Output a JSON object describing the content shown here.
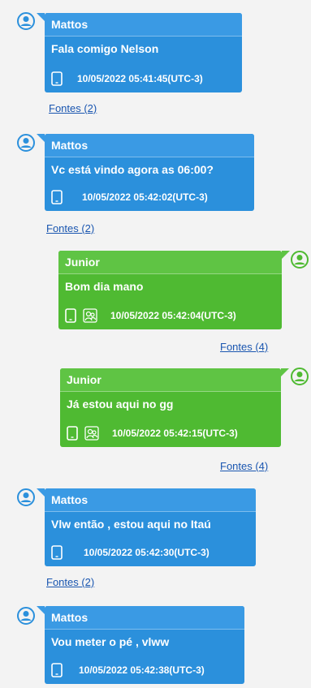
{
  "colors": {
    "incoming_bubble": "#2b90dc",
    "outgoing_bubble": "#4fba32",
    "link": "#1a56b0",
    "background": "#f3f3f3"
  },
  "messages": [
    {
      "sender": "Mattos",
      "text": "Fala comigo Nelson",
      "timestamp": "10/05/2022 05:41:45(UTC-3)",
      "sources": "Fontes (2)",
      "icons": [
        "phone-icon"
      ]
    },
    {
      "sender": "Mattos",
      "text": "Vc está vindo agora as 06:00?",
      "timestamp": "10/05/2022 05:42:02(UTC-3)",
      "sources": "Fontes (2)",
      "icons": [
        "phone-icon"
      ]
    },
    {
      "sender": "Junior",
      "text": "Bom dia mano",
      "timestamp": "10/05/2022 05:42:04(UTC-3)",
      "sources": "Fontes (4)",
      "icons": [
        "phone-icon",
        "group-icon"
      ]
    },
    {
      "sender": "Junior",
      "text": "Já estou aqui no gg",
      "timestamp": "10/05/2022 05:42:15(UTC-3)",
      "sources": "Fontes (4)",
      "icons": [
        "phone-icon",
        "group-icon"
      ]
    },
    {
      "sender": "Mattos",
      "text": "Vlw então , estou aqui no Itaú",
      "timestamp": "10/05/2022 05:42:30(UTC-3)",
      "sources": "Fontes (2)",
      "icons": [
        "phone-icon"
      ]
    },
    {
      "sender": "Mattos",
      "text": "Vou meter o pé , vlww",
      "timestamp": "10/05/2022 05:42:38(UTC-3)",
      "icons": [
        "phone-icon"
      ]
    }
  ]
}
